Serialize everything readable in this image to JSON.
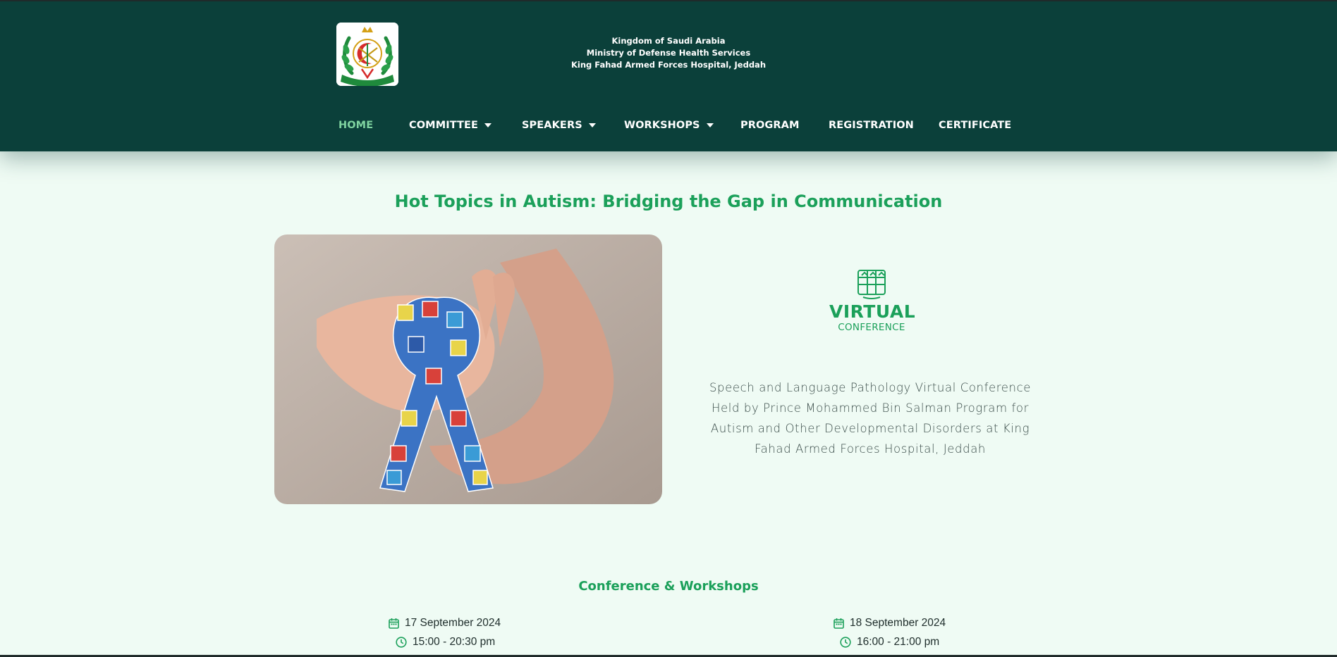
{
  "header": {
    "logo_icon": "military-emblem-logo",
    "org_lines": [
      "Kingdom of Saudi Arabia",
      "Ministry of Defense Health Services",
      "King Fahad Armed Forces Hospital, Jeddah"
    ],
    "nav": [
      {
        "label": "HOME",
        "active": true,
        "dropdown": false
      },
      {
        "label": "COMMITTEE",
        "active": false,
        "dropdown": true
      },
      {
        "label": "SPEAKERS",
        "active": false,
        "dropdown": true
      },
      {
        "label": "WORKSHOPS",
        "active": false,
        "dropdown": true
      },
      {
        "label": "PROGRAM",
        "active": false,
        "dropdown": false
      },
      {
        "label": "REGISTRATION",
        "active": false,
        "dropdown": false
      },
      {
        "label": "CERTIFICATE",
        "active": false,
        "dropdown": false
      }
    ]
  },
  "hero": {
    "title": "Hot Topics in Autism: Bridging the Gap in Communication",
    "photo_icon": "autism-awareness-ribbon-hands-photo",
    "vc_logo": {
      "line1": "VIRTUAL",
      "line2": "CONFERENCE"
    },
    "description": "Speech and Language Pathology Virtual Conference Held by Prince Mohammed Bin Salman Program for Autism and Other Developmental Disorders at King Fahad Armed Forces Hospital, Jeddah"
  },
  "schedule": {
    "title": "Conference & Workshops",
    "days": [
      {
        "date": "17 September 2024",
        "time": "15:00 - 20:30 pm"
      },
      {
        "date": "18 September 2024",
        "time": "16:00 - 21:00 pm"
      }
    ]
  },
  "colors": {
    "header_bg": "#0b403a",
    "accent_green": "#1ba05a",
    "active_nav": "#7fd3a0",
    "page_bg": "#effbf4"
  }
}
